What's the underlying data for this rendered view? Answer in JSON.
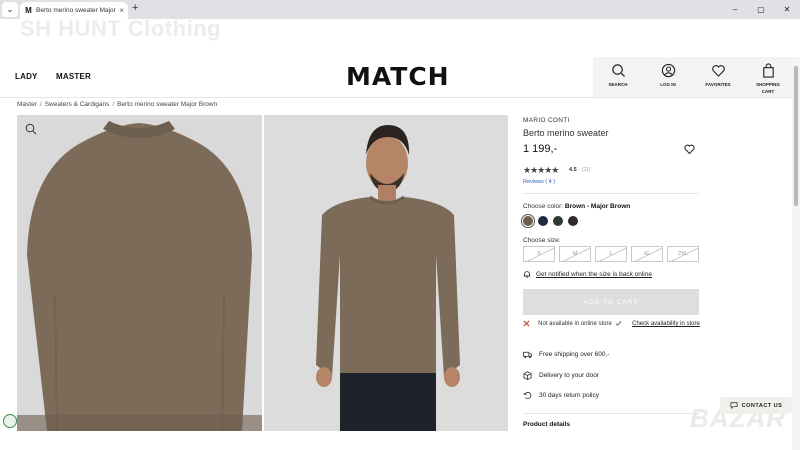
{
  "browser": {
    "tab_title": "Berto merino sweater Major B...",
    "tab_favicon": "M",
    "tab_close": "×",
    "new_tab": "+",
    "window_controls": [
      "–",
      "▢",
      "✕"
    ]
  },
  "watermark_top": "SH HUNT Clothing",
  "header": {
    "nav": [
      "LADY",
      "MASTER"
    ],
    "logo": "MATCH",
    "icons": [
      {
        "label": "SEARCH",
        "icon": "search-icon"
      },
      {
        "label": "LOG IN",
        "icon": "user-icon"
      },
      {
        "label": "FAVORITES",
        "icon": "heart-icon"
      },
      {
        "label": "SHOPPING CART",
        "icon": "bag-icon"
      }
    ]
  },
  "breadcrumb": [
    "Master",
    "Sweaters & Cardigans",
    "Berto merino sweater Major Brown"
  ],
  "product": {
    "brand": "MARIO CONTI",
    "name": "Berto merino sweater",
    "price": "1 199,-",
    "rating": "4.5",
    "rating_count": "(11)",
    "reviews_link": "Reviews ( 4 )",
    "color_label": "Choose color:",
    "color_value": "Brown - Major Brown",
    "swatches": [
      "#6e5e4e",
      "#1f2a44",
      "#2d3b33",
      "#2b2b2b"
    ],
    "size_label": "Choose size:",
    "sizes": [
      "S",
      "M",
      "L",
      "XL",
      "2XL"
    ],
    "notify_text": "Get notified when the size is back online",
    "add_to_cart": "ADD TO CART",
    "not_available": "Not available in online store",
    "check_availability": "Check availability in store",
    "features": [
      "Free shipping over 600,-",
      "Delivery to your door",
      "30 days return policy"
    ],
    "details_heading": "Product details"
  },
  "contact_button": "CONTACT US",
  "watermark_bottom": "BAZAR",
  "colors": {
    "accent_link": "#2b5bb7",
    "disabled_button": "#dedede",
    "text": "#111111"
  }
}
